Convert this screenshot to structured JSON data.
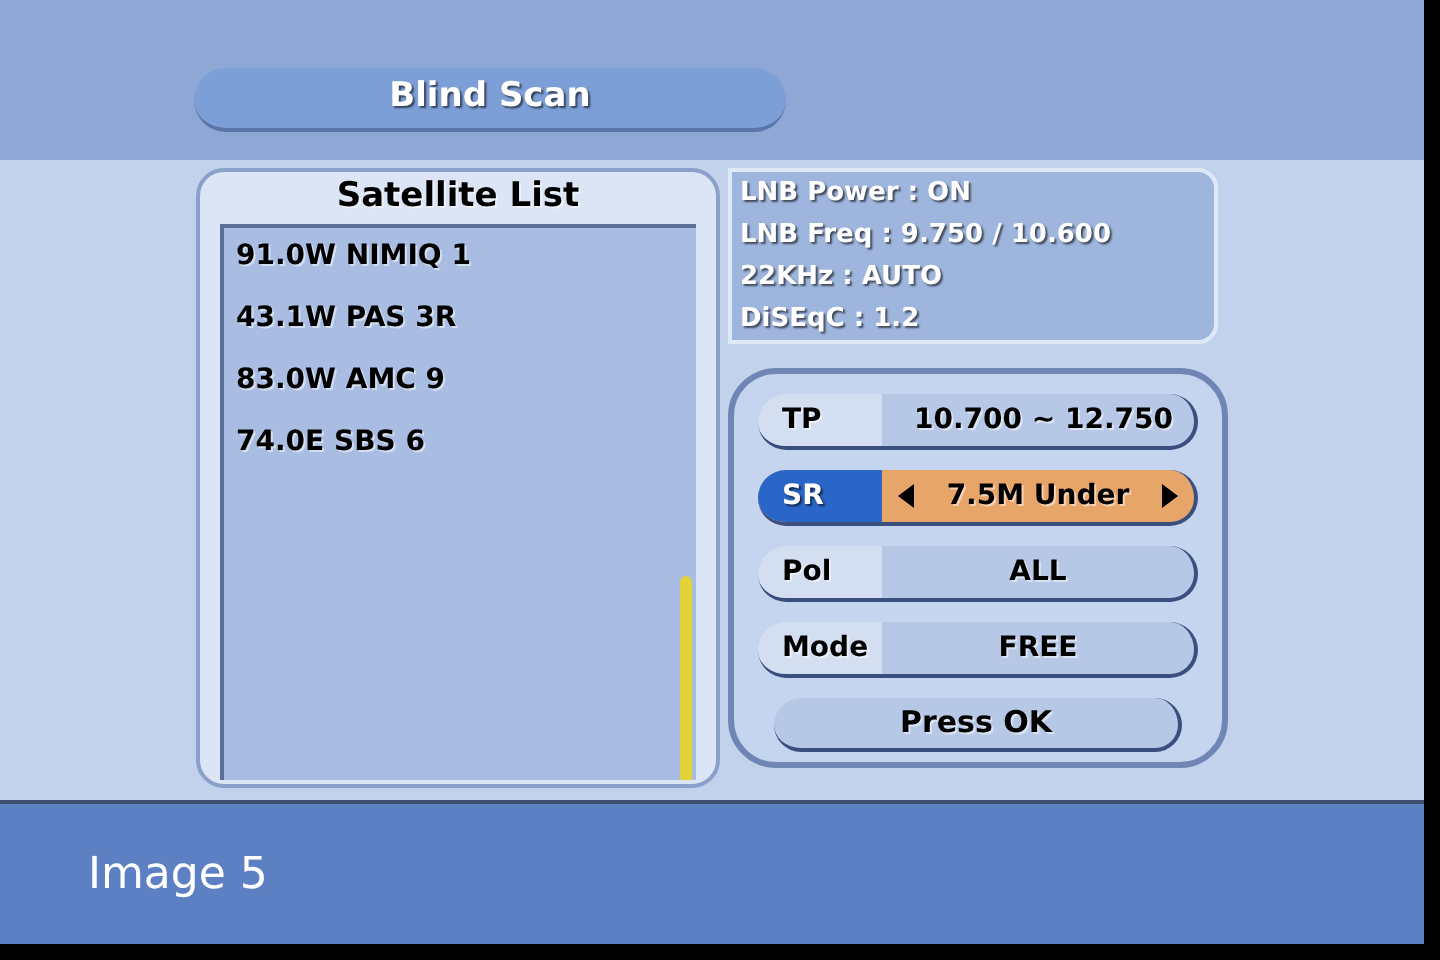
{
  "title": "Blind Scan",
  "satellite_list": {
    "heading": "Satellite List",
    "items": [
      "91.0W NIMIQ 1",
      "43.1W PAS 3R",
      "83.0W AMC 9",
      "74.0E SBS 6"
    ]
  },
  "lnb_info": [
    "LNB Power : ON",
    "LNB Freq : 9.750 / 10.600",
    "22KHz : AUTO",
    "DiSEqC : 1.2"
  ],
  "settings": [
    {
      "label": "TP",
      "value": "10.700 ~ 12.750",
      "selected": false
    },
    {
      "label": "SR",
      "value": "7.5M Under",
      "selected": true
    },
    {
      "label": "Pol",
      "value": "ALL",
      "selected": false
    },
    {
      "label": "Mode",
      "value": "FREE",
      "selected": false
    }
  ],
  "action_button": "Press OK",
  "caption": "Image 5"
}
